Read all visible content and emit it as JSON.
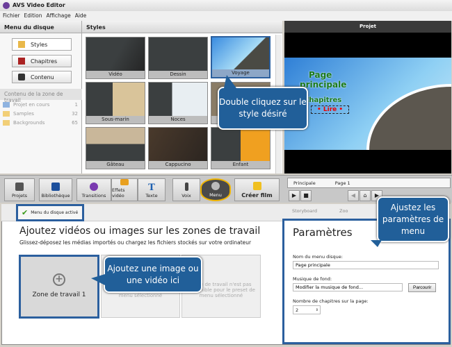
{
  "window": {
    "title": "AVS Video Editor"
  },
  "menubar": [
    "Fichier",
    "Edition",
    "Affichage",
    "Aide"
  ],
  "left": {
    "header": "Menu du disque",
    "buttons": [
      "Styles",
      "Chapitres",
      "Contenu"
    ],
    "section": "Contenu de la zone de travail",
    "items": [
      {
        "label": "Projet en cours",
        "count": "1"
      },
      {
        "label": "Samples",
        "count": "32"
      },
      {
        "label": "Backgrounds",
        "count": "65"
      }
    ]
  },
  "styles": {
    "header": "Styles",
    "tiles": [
      "Vidéo",
      "Dessin",
      "Voyage",
      "Sous-marin",
      "Noces",
      "",
      "Gâteau",
      "Cappucino",
      "Enfant"
    ],
    "selected": "Voyage"
  },
  "projet": {
    "header": "Projet",
    "preview": {
      "title1": "Page",
      "title2": "principale",
      "chapters": "Chapitres",
      "play": "• Lire •"
    }
  },
  "toolbar": {
    "buttons": [
      "Projets",
      "Bibliothèque",
      "Transitions",
      "Effets vidéo",
      "Texte",
      "Voix",
      "Menu",
      "Créer film"
    ],
    "active": "Menu"
  },
  "player": {
    "tabs": [
      "Principale",
      "Page 1"
    ]
  },
  "bottom": {
    "disc_menu_activated": "Menu du disque activé",
    "storyboard": "Storyboard",
    "zoom": "Zoo",
    "headline": "Ajoutez vidéos ou images sur les zones de travail",
    "subline": "Glissez-déposez les médias importés ou chargez les fichiers stockés sur votre ordinateur",
    "zone1": "Zone de travail 1",
    "zone_unavailable": "Zone de travail n'est pas disponible pour le preset de menu sélectionné"
  },
  "params": {
    "title": "Paramètres",
    "name_label": "Nom du menu disque:",
    "name_value": "Page principale",
    "music_label": "Musique de fond:",
    "music_value": "Modifier la musique de fond...",
    "browse": "Parcourir",
    "chapters_label": "Nombre de chapitres sur la page:",
    "chapters_value": "2"
  },
  "callouts": {
    "styles": "Double cliquez sur le style désiré",
    "params": "Ajustez les paramètres de menu",
    "zone": "Ajoutez une image ou une vidéo ici"
  },
  "colors": {
    "accent": "#215f99",
    "highlight": "#f0b400"
  }
}
